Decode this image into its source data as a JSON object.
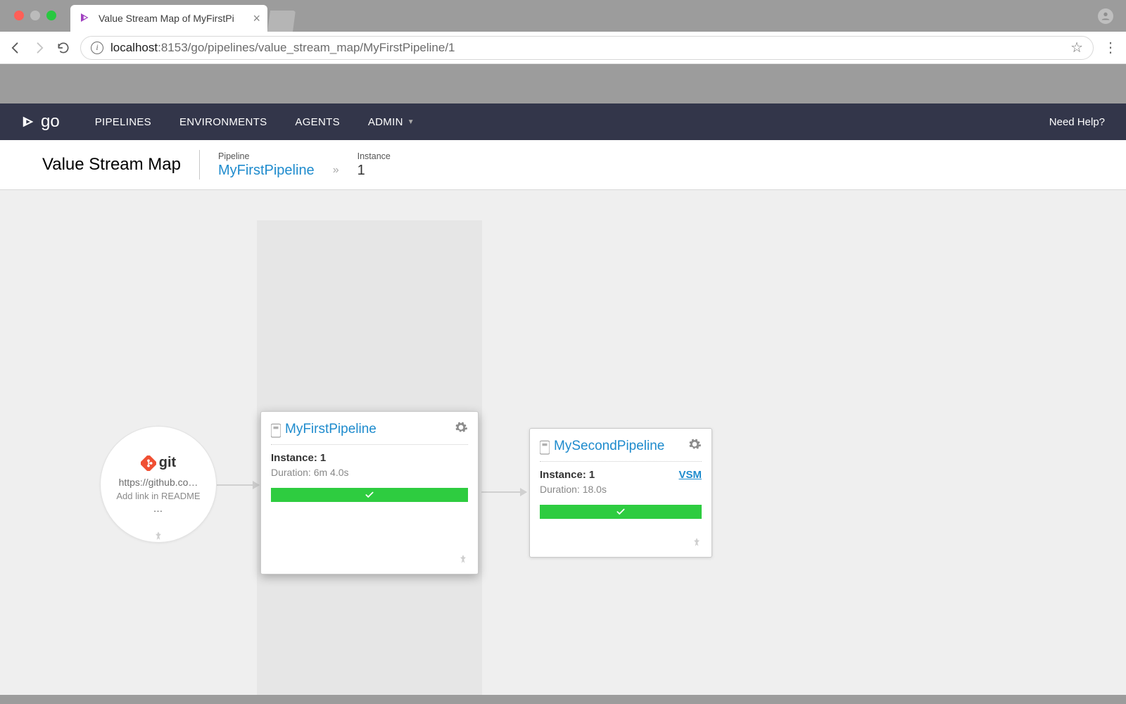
{
  "browser": {
    "tab_title": "Value Stream Map of MyFirstPi",
    "url_host": "localhost",
    "url_port_path": ":8153/go/pipelines/value_stream_map/MyFirstPipeline/1"
  },
  "nav": {
    "logo_text": "go",
    "items": [
      "PIPELINES",
      "ENVIRONMENTS",
      "AGENTS",
      "ADMIN"
    ],
    "need_help": "Need Help?"
  },
  "header": {
    "title": "Value Stream Map",
    "pipeline_label": "Pipeline",
    "pipeline_value": "MyFirstPipeline",
    "instance_label": "Instance",
    "instance_value": "1"
  },
  "git_node": {
    "logo_text": "git",
    "url": "https://github.co…",
    "commit_msg": "Add link in README",
    "more": "…"
  },
  "pipelines": {
    "first": {
      "name": "MyFirstPipeline",
      "instance_label": "Instance:",
      "instance_value": "1",
      "duration_label": "Duration:",
      "duration_value": "6m 4.0s"
    },
    "second": {
      "name": "MySecondPipeline",
      "instance_label": "Instance:",
      "instance_value": "1",
      "duration_label": "Duration:",
      "duration_value": "18.0s",
      "vsm_link": "VSM"
    }
  }
}
